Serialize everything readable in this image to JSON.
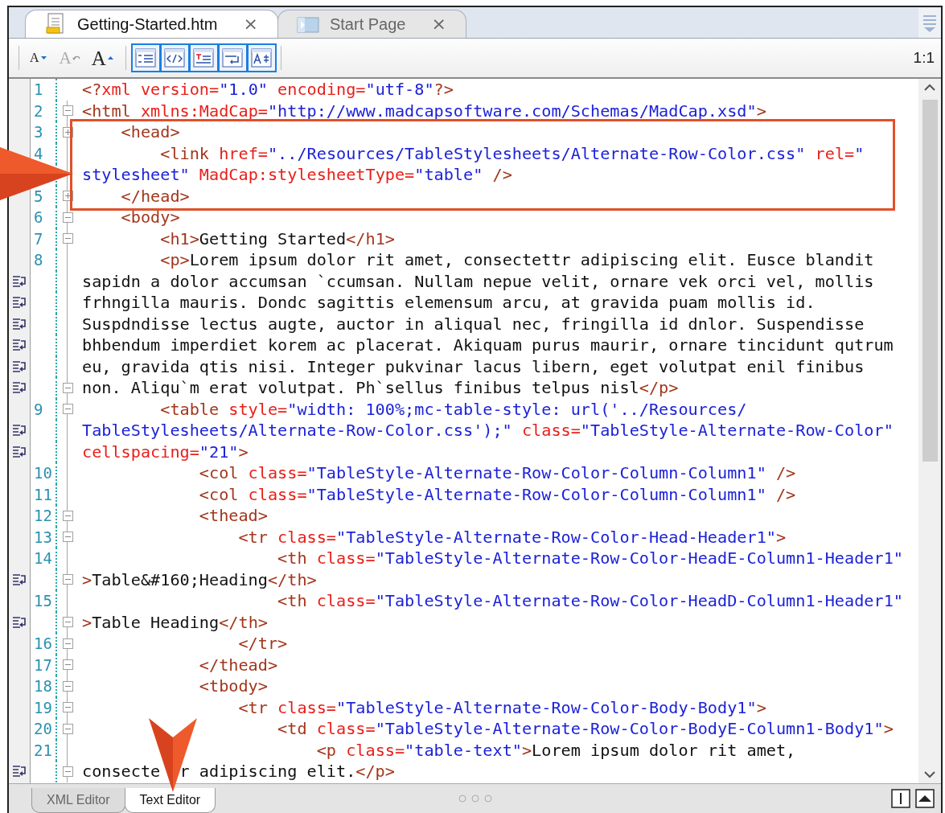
{
  "tabs": [
    {
      "title": "Getting-Started.htm",
      "close": "×",
      "selected": true,
      "kind": "document"
    },
    {
      "title": "Start Page",
      "close": "×",
      "selected": false,
      "kind": "start"
    }
  ],
  "toolbar": {
    "font_buttons": [
      {
        "label": "A",
        "kind": "decrease",
        "disabled": false
      },
      {
        "label": "A",
        "kind": "reset",
        "disabled": true
      },
      {
        "label": "A",
        "kind": "increase",
        "disabled": false
      }
    ],
    "view_toggles": [
      {
        "kind": "line-numbers",
        "on": true
      },
      {
        "kind": "tags",
        "on": true
      },
      {
        "kind": "syntax-color",
        "on": true
      },
      {
        "kind": "word-wrap",
        "on": true
      },
      {
        "kind": "auto-format",
        "on": true
      }
    ],
    "zoom": "1:1"
  },
  "editor": {
    "rows": [
      {
        "number": "1",
        "wrapped": false,
        "kind": "none",
        "tokens": [
          {
            "kind": "tag",
            "text": "<?"
          },
          {
            "kind": "attr",
            "text": "xml version="
          },
          {
            "kind": "value",
            "text": "\"1.0\""
          },
          {
            "kind": "attr",
            "text": " encoding="
          },
          {
            "kind": "value",
            "text": "\"utf-8\""
          },
          {
            "kind": "tag",
            "text": "?>"
          }
        ]
      },
      {
        "number": "2",
        "wrapped": false,
        "kind": "collapse",
        "tokens": [
          {
            "kind": "tag",
            "text": "<html"
          },
          {
            "kind": "attr",
            "text": " xmlns:MadCap="
          },
          {
            "kind": "value",
            "text": "\"http://www.madcapsoftware.com/Schemas/MadCap.xsd\""
          },
          {
            "kind": "tag",
            "text": ">"
          }
        ]
      },
      {
        "number": "3",
        "wrapped": false,
        "kind": "expand",
        "tokens": [
          {
            "kind": "tag",
            "text": "    <head>"
          }
        ]
      },
      {
        "number": "4",
        "wrapped": false,
        "kind": "line",
        "tokens": [
          {
            "kind": "tag",
            "text": "        <link"
          },
          {
            "kind": "attr",
            "text": " href="
          },
          {
            "kind": "value",
            "text": "\"../Resources/TableStylesheets/Alternate-Row-Color.css\""
          },
          {
            "kind": "attr",
            "text": " rel="
          },
          {
            "kind": "value",
            "text": "\""
          }
        ]
      },
      {
        "wrapped": false,
        "kind": "line",
        "tokens": [
          {
            "kind": "value",
            "text": "stylesheet\""
          },
          {
            "kind": "attr",
            "text": " MadCap:stylesheetType="
          },
          {
            "kind": "value",
            "text": "\"table\""
          },
          {
            "kind": "tag",
            "text": " />"
          }
        ]
      },
      {
        "number": "5",
        "wrapped": false,
        "kind": "expand",
        "tokens": [
          {
            "kind": "tag",
            "text": "    </head>"
          }
        ]
      },
      {
        "number": "6",
        "wrapped": false,
        "kind": "collapse",
        "tokens": [
          {
            "kind": "tag",
            "text": "    <body>"
          }
        ]
      },
      {
        "number": "7",
        "wrapped": false,
        "kind": "collapse",
        "tokens": [
          {
            "kind": "tag",
            "text": "        <h1>"
          },
          {
            "kind": "text",
            "text": "Getting Started"
          },
          {
            "kind": "tag",
            "text": "</h1>"
          }
        ]
      },
      {
        "number": "8",
        "wrapped": false,
        "kind": "line",
        "tokens": [
          {
            "kind": "tag",
            "text": "        <p>"
          },
          {
            "kind": "text",
            "text": "Lorem ipsum dolor rit amet, consectettr adipiscing elit. Eusce blandit"
          }
        ]
      },
      {
        "wrapped": true,
        "kind": "line",
        "tokens": [
          {
            "kind": "text",
            "text": "sapidn a dolor accumsan `ccumsan. Nullam nepue velit, ornare vek orci vel, mollis"
          }
        ]
      },
      {
        "wrapped": true,
        "kind": "line",
        "tokens": [
          {
            "kind": "text",
            "text": "frhngilla mauris. Dondc sagittis elemensum arcu, at gravida puam mollis id."
          }
        ]
      },
      {
        "wrapped": true,
        "kind": "line",
        "tokens": [
          {
            "kind": "text",
            "text": "Suspdndisse lectus augte, auctor in aliqual nec, fringilla id dnlor. Suspendisse"
          }
        ]
      },
      {
        "wrapped": true,
        "kind": "line",
        "tokens": [
          {
            "kind": "text",
            "text": "bhbendum imperdiet korem ac placerat. Akiquam purus maurir, ornare tincidunt qutrum"
          }
        ]
      },
      {
        "wrapped": true,
        "kind": "line",
        "tokens": [
          {
            "kind": "text",
            "text": "eu, gravida qtis nisi. Integer pukvinar lacus libern, eget volutpat enil finibus"
          }
        ]
      },
      {
        "wrapped": true,
        "kind": "collapse",
        "tokens": [
          {
            "kind": "text",
            "text": "non. Aliqu`m erat volutpat. Ph`sellus finibus telpus nisl"
          },
          {
            "kind": "tag",
            "text": "</p>"
          }
        ]
      },
      {
        "number": "9",
        "wrapped": false,
        "kind": "collapse",
        "tokens": [
          {
            "kind": "tag",
            "text": "        <table"
          },
          {
            "kind": "attr",
            "text": " style="
          },
          {
            "kind": "value",
            "text": "\"width: 100%;mc-table-style: url('../Resources/"
          }
        ]
      },
      {
        "wrapped": true,
        "kind": "line",
        "tokens": [
          {
            "kind": "value",
            "text": "TableStylesheets/Alternate-Row-Color.css');\""
          },
          {
            "kind": "attr",
            "text": " class="
          },
          {
            "kind": "value",
            "text": "\"TableStyle-Alternate-Row-Color\""
          }
        ]
      },
      {
        "wrapped": true,
        "kind": "line",
        "tokens": [
          {
            "kind": "attr",
            "text": "cellspacing="
          },
          {
            "kind": "value",
            "text": "\"21\""
          },
          {
            "kind": "tag",
            "text": ">"
          }
        ]
      },
      {
        "number": "10",
        "wrapped": false,
        "kind": "line",
        "tokens": [
          {
            "kind": "tag",
            "text": "            <col"
          },
          {
            "kind": "attr",
            "text": " class="
          },
          {
            "kind": "value",
            "text": "\"TableStyle-Alternate-Row-Color-Column-Column1\""
          },
          {
            "kind": "tag",
            "text": " />"
          }
        ]
      },
      {
        "number": "11",
        "wrapped": false,
        "kind": "line",
        "tokens": [
          {
            "kind": "tag",
            "text": "            <col"
          },
          {
            "kind": "attr",
            "text": " class="
          },
          {
            "kind": "value",
            "text": "\"TableStyle-Alternate-Row-Color-Column-Column1\""
          },
          {
            "kind": "tag",
            "text": " />"
          }
        ]
      },
      {
        "number": "12",
        "wrapped": false,
        "kind": "collapse",
        "tokens": [
          {
            "kind": "tag",
            "text": "            <thead>"
          }
        ]
      },
      {
        "number": "13",
        "wrapped": false,
        "kind": "collapse",
        "tokens": [
          {
            "kind": "tag",
            "text": "                <tr"
          },
          {
            "kind": "attr",
            "text": " class="
          },
          {
            "kind": "value",
            "text": "\"TableStyle-Alternate-Row-Color-Head-Header1\""
          },
          {
            "kind": "tag",
            "text": ">"
          }
        ]
      },
      {
        "number": "14",
        "wrapped": false,
        "kind": "line",
        "tokens": [
          {
            "kind": "tag",
            "text": "                    <th"
          },
          {
            "kind": "attr",
            "text": " class="
          },
          {
            "kind": "value",
            "text": "\"TableStyle-Alternate-Row-Color-HeadE-Column1-Header1\""
          }
        ]
      },
      {
        "wrapped": true,
        "kind": "collapse",
        "tokens": [
          {
            "kind": "tag",
            "text": ">"
          },
          {
            "kind": "text",
            "text": "Table&#160;Heading"
          },
          {
            "kind": "tag",
            "text": "</th>"
          }
        ]
      },
      {
        "number": "15",
        "wrapped": false,
        "kind": "line",
        "tokens": [
          {
            "kind": "tag",
            "text": "                    <th"
          },
          {
            "kind": "attr",
            "text": " class="
          },
          {
            "kind": "value",
            "text": "\"TableStyle-Alternate-Row-Color-HeadD-Column1-Header1\""
          }
        ]
      },
      {
        "wrapped": true,
        "kind": "collapse",
        "tokens": [
          {
            "kind": "tag",
            "text": ">"
          },
          {
            "kind": "text",
            "text": "Table Heading"
          },
          {
            "kind": "tag",
            "text": "</th>"
          }
        ]
      },
      {
        "number": "16",
        "wrapped": false,
        "kind": "collapse",
        "tokens": [
          {
            "kind": "tag",
            "text": "                </tr>"
          }
        ]
      },
      {
        "number": "17",
        "wrapped": false,
        "kind": "collapse",
        "tokens": [
          {
            "kind": "tag",
            "text": "            </thead>"
          }
        ]
      },
      {
        "number": "18",
        "wrapped": false,
        "kind": "collapse",
        "tokens": [
          {
            "kind": "tag",
            "text": "            <tbody>"
          }
        ]
      },
      {
        "number": "19",
        "wrapped": false,
        "kind": "collapse",
        "tokens": [
          {
            "kind": "tag",
            "text": "                <tr"
          },
          {
            "kind": "attr",
            "text": " class="
          },
          {
            "kind": "value",
            "text": "\"TableStyle-Alternate-Row-Color-Body-Body1\""
          },
          {
            "kind": "tag",
            "text": ">"
          }
        ]
      },
      {
        "number": "20",
        "wrapped": false,
        "kind": "collapse",
        "tokens": [
          {
            "kind": "tag",
            "text": "                    <td"
          },
          {
            "kind": "attr",
            "text": " class="
          },
          {
            "kind": "value",
            "text": "\"TableStyle-Alternate-Row-Color-BodyE-Column1-Body1\""
          },
          {
            "kind": "tag",
            "text": ">"
          }
        ]
      },
      {
        "number": "21",
        "wrapped": false,
        "kind": "line",
        "tokens": [
          {
            "kind": "tag",
            "text": "                        <p"
          },
          {
            "kind": "attr",
            "text": " class="
          },
          {
            "kind": "value",
            "text": "\"table-text\""
          },
          {
            "kind": "tag",
            "text": ">"
          },
          {
            "kind": "text",
            "text": "Lorem ipsum dolor rit amet,"
          }
        ]
      },
      {
        "wrapped": true,
        "kind": "collapse",
        "tokens": [
          {
            "kind": "text",
            "text": "consecte"
          },
          {
            "kind": "text",
            "text": "  r adipiscing elit."
          },
          {
            "kind": "tag",
            "text": "</p>"
          }
        ]
      }
    ]
  },
  "bottom_tabs": [
    {
      "label": "XML Editor",
      "selected": false
    },
    {
      "label": "Text Editor",
      "selected": true
    }
  ]
}
